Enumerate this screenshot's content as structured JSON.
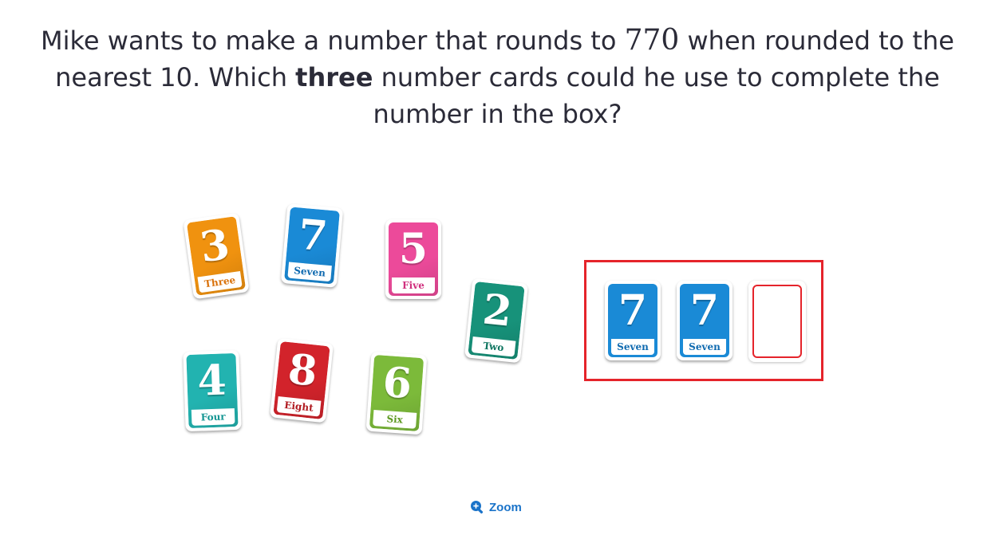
{
  "question": {
    "part1": "Mike wants to make a number that rounds to ",
    "number": "770",
    "part2": " when rounded to the nearest 10. Which ",
    "emphasis": "three",
    "part3": " number cards could he use to complete the number in the box?"
  },
  "cards": [
    {
      "digit": "3",
      "word": "Three",
      "color": "#f0920f",
      "text_color": "#d9710a"
    },
    {
      "digit": "7",
      "word": "Seven",
      "color": "#1a8ad6",
      "text_color": "#0f6ab0"
    },
    {
      "digit": "5",
      "word": "Five",
      "color": "#ec4a9a",
      "text_color": "#d0307e"
    },
    {
      "digit": "2",
      "word": "Two",
      "color": "#17927a",
      "text_color": "#0e7560"
    },
    {
      "digit": "4",
      "word": "Four",
      "color": "#22b3b0",
      "text_color": "#159693"
    },
    {
      "digit": "8",
      "word": "Eight",
      "color": "#d2232b",
      "text_color": "#b01a20"
    },
    {
      "digit": "6",
      "word": "Six",
      "color": "#7cba3a",
      "text_color": "#5e9a22"
    }
  ],
  "answer_slots": [
    {
      "digit": "7",
      "word": "Seven",
      "color": "#1a8ad6",
      "text_color": "#0f6ab0"
    },
    {
      "digit": "7",
      "word": "Seven",
      "color": "#1a8ad6",
      "text_color": "#0f6ab0"
    },
    {
      "digit": "",
      "word": "",
      "empty": true
    }
  ],
  "zoom": {
    "label": "Zoom",
    "icon": "zoom-in-icon",
    "color": "#1a73c9"
  },
  "answer_box_color": "#e5242b"
}
